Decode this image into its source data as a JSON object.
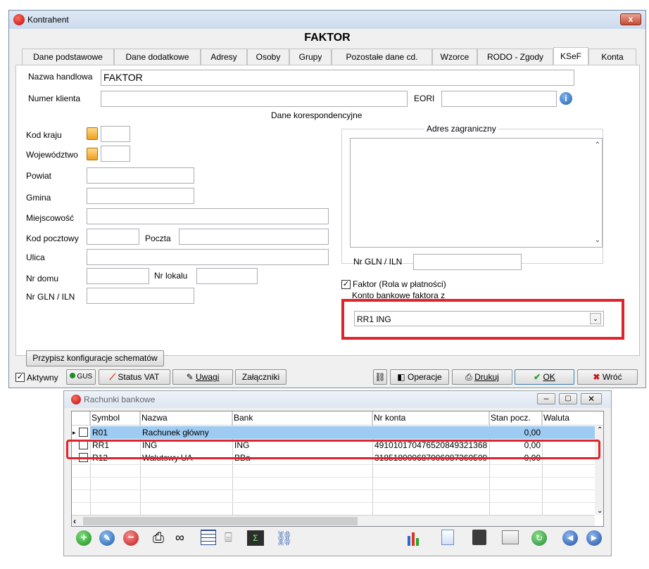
{
  "window": {
    "title": "Kontrahent",
    "close_label": "x",
    "header": "FAKTOR"
  },
  "tabs": [
    "Dane podstawowe",
    "Dane dodatkowe",
    "Adresy",
    "Osoby",
    "Grupy",
    "Pozostałe dane cd.",
    "Wzorce",
    "RODO - Zgody",
    "KSeF",
    "Konta"
  ],
  "active_tab": "KSeF",
  "form": {
    "nazwa_label": "Nazwa handlowa",
    "nazwa_value": "FAKTOR",
    "numer_label": "Numer klienta",
    "numer_value": "",
    "eori_label": "EORI",
    "eori_value": "",
    "dane_kor": "Dane korespondencyjne",
    "kod_kraju": "Kod kraju",
    "wojewodztwo": "Województwo",
    "powiat": "Powiat",
    "gmina": "Gmina",
    "miejscowosc": "Miejscowość",
    "kod_pocztowy": "Kod pocztowy",
    "poczta": "Poczta",
    "ulica": "Ulica",
    "nr_domu": "Nr domu",
    "nr_lokalu": "Nr lokalu",
    "nr_gln": "Nr GLN / ILN",
    "adres_zagraniczny": "Adres zagraniczny",
    "nr_gln2": "Nr GLN / ILN",
    "faktor_checkbox": "Faktor (Rola w płatności)",
    "faktor_checked": true,
    "konto_label": "Konto bankowe faktora z",
    "konto_value": "RR1 ING",
    "przypisz_button": "Przypisz konfiguracje schematów"
  },
  "footer": {
    "aktywny": "Aktywny",
    "aktywny_checked": true,
    "gus": "GUS",
    "status_vat": "Status VAT",
    "uwagi": "Uwagi",
    "zalaczniki": "Załączniki",
    "operacje": "Operacje",
    "drukuj": "Drukuj",
    "ok": "OK",
    "wroc": "Wróć"
  },
  "rachunki": {
    "title": "Rachunki bankowe",
    "columns": [
      "Symbol",
      "Nazwa",
      "Bank",
      "Nr konta",
      "Stan pocz.",
      "Waluta"
    ],
    "rows": [
      {
        "symbol": "R01",
        "nazwa": "Rachunek główny",
        "bank": "",
        "nr_konta": "",
        "stan": "0,00",
        "waluta": ""
      },
      {
        "symbol": "RR1",
        "nazwa": "ING",
        "bank": "ING",
        "nr_konta": "491010170476520849321368",
        "stan": "0,00",
        "waluta": ""
      },
      {
        "symbol": "R12",
        "nazwa": "Walutowy UA",
        "bank": "BBa",
        "nr_konta": "318518000687006087360509",
        "stan": "0,00",
        "waluta": ""
      }
    ]
  },
  "colors": {
    "highlight_red": "#e0242b",
    "selected_row": "#9ecbf2"
  }
}
